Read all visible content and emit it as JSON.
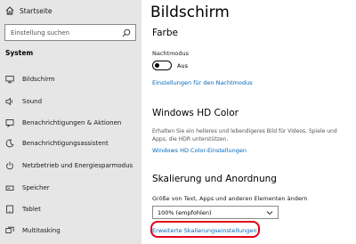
{
  "sidebar": {
    "home_label": "Startseite",
    "search_placeholder": "Einstellung suchen",
    "section_label": "System",
    "items": [
      {
        "label": "Bildschirm",
        "icon": "monitor-icon"
      },
      {
        "label": "Sound",
        "icon": "speaker-icon"
      },
      {
        "label": "Benachrichtigungen & Aktionen",
        "icon": "notification-icon"
      },
      {
        "label": "Benachrichtigungsassistent",
        "icon": "moon-icon"
      },
      {
        "label": "Netzbetrieb und Energiesparmodus",
        "icon": "power-icon"
      },
      {
        "label": "Speicher",
        "icon": "storage-icon"
      },
      {
        "label": "Tablet",
        "icon": "tablet-icon"
      },
      {
        "label": "Multitasking",
        "icon": "multitasking-icon"
      }
    ]
  },
  "main": {
    "title": "Bildschirm",
    "color_section": {
      "heading": "Farbe",
      "night_mode_label": "Nachtmodus",
      "toggle_state": "Aus",
      "night_mode_link": "Einstellungen für den Nachtmodus"
    },
    "hd_section": {
      "heading": "Windows HD Color",
      "description": "Erhalten Sie ein helleres und lebendigeres Bild für Videos, Spiele und Apps, die HDR unterstützen.",
      "link": "Windows HD Color-Einstellungen"
    },
    "scale_section": {
      "heading": "Skalierung und Anordnung",
      "size_label": "Größe von Text, Apps und anderen Elementen ändern",
      "dropdown_value": "100% (empfohlen)",
      "advanced_link": "Erweiterte Skalierungseinstellungen"
    }
  },
  "colors": {
    "sidebar_bg": "#e6e6e6",
    "link": "#0067b8",
    "highlight": "#e2001a"
  }
}
